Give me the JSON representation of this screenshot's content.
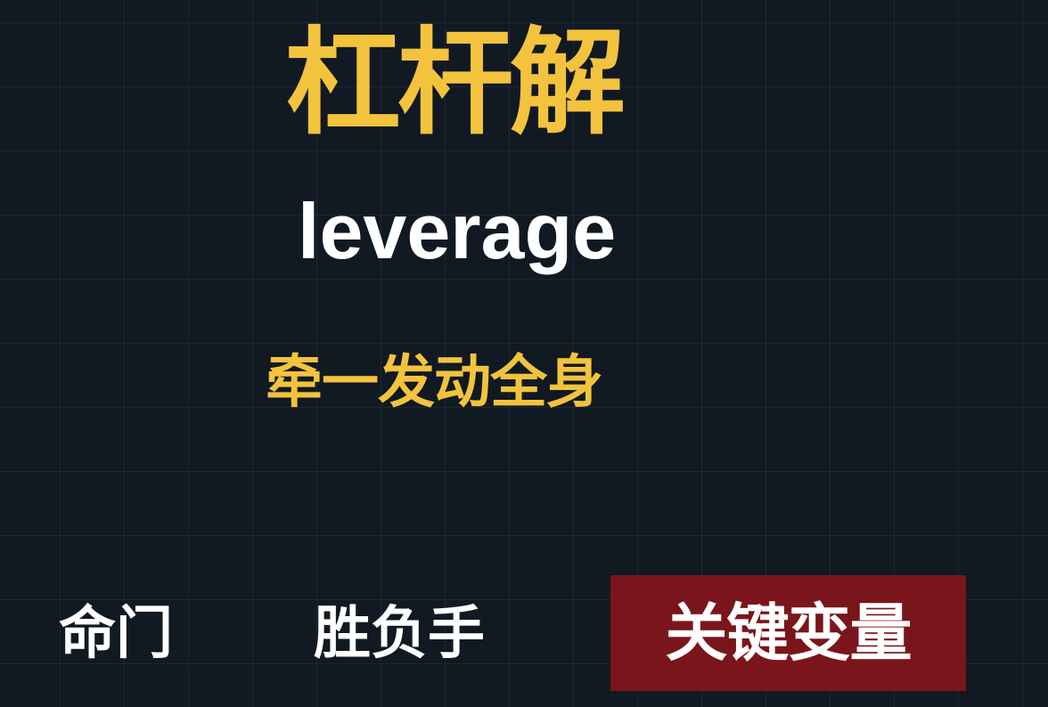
{
  "title": "杠杆解",
  "term": "leverage",
  "tagline": "牵一发动全身",
  "tags": [
    {
      "label": "命门"
    },
    {
      "label": "胜负手"
    },
    {
      "label": "关键变量",
      "highlighted": true
    }
  ],
  "colors": {
    "background": "#111922",
    "accent_yellow": "#f3c33d",
    "text_white": "#ffffff",
    "highlight_red": "#7a161b"
  }
}
